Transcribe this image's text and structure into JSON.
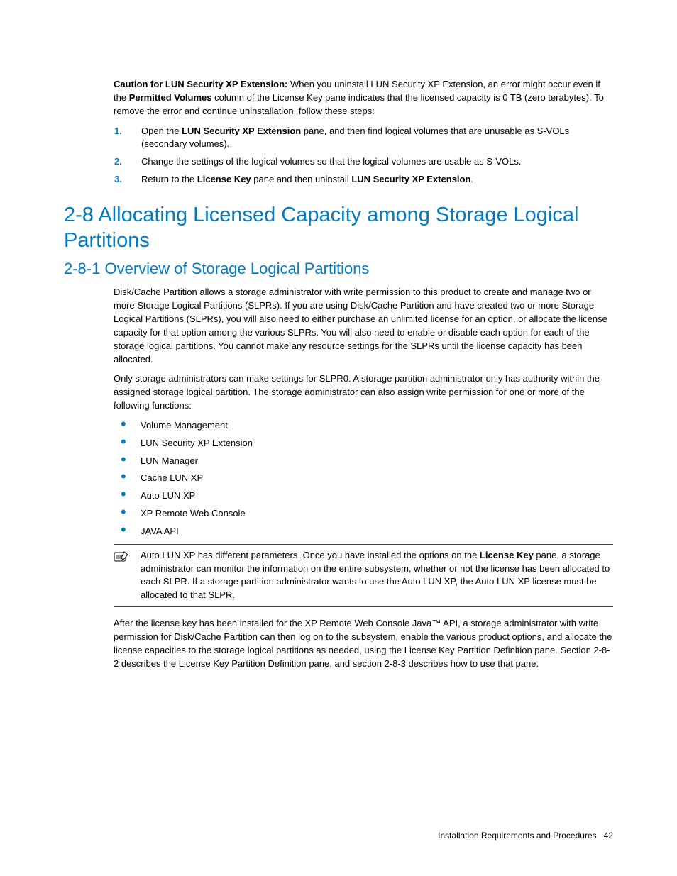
{
  "caution": {
    "lead_bold": "Caution for LUN Security XP Extension: ",
    "lead_text1": "When you uninstall LUN Security XP Extension, an error might occur even if the ",
    "bold_permitted": "Permitted Volumes",
    "lead_text2": " column of the License Key pane indicates that the licensed capacity is 0 TB (zero terabytes). To remove the error and continue uninstallation, follow these steps:"
  },
  "steps": [
    {
      "num": "1.",
      "pre": "Open the ",
      "bold": "LUN Security XP Extension",
      "post": " pane, and then find logical volumes that are unusable as S-VOLs (secondary volumes)."
    },
    {
      "num": "2.",
      "text": "Change the settings of the logical volumes so that the logical volumes are usable as S-VOLs."
    },
    {
      "num": "3.",
      "pre": "Return to the ",
      "bold1": "License Key",
      "mid": " pane and then uninstall ",
      "bold2": "LUN Security XP Extension",
      "post": "."
    }
  ],
  "h1": "2-8 Allocating Licensed Capacity among Storage Logical Partitions",
  "h2": "2-8-1 Overview of Storage Logical Partitions",
  "para1": "Disk/Cache Partition allows a storage administrator with write permission to this product to create and manage two or more Storage Logical Partitions (SLPRs). If you are using Disk/Cache Partition and have created two or more Storage Logical Partitions (SLPRs), you will also need to either purchase an unlimited license for an option, or allocate the license capacity for that option among the various SLPRs. You will also need to enable or disable each option for each of the storage logical partitions. You cannot make any resource settings for the SLPRs until the license capacity has been allocated.",
  "para2": "Only storage administrators can make settings for SLPR0. A storage partition administrator only has authority within the assigned storage logical partition. The storage administrator can also assign write permission for one or more of the following functions:",
  "bullets": [
    "Volume Management",
    "LUN Security XP Extension",
    "LUN Manager",
    "Cache LUN XP",
    "Auto LUN XP",
    "XP Remote Web Console",
    "JAVA API"
  ],
  "note": {
    "pre": "Auto LUN XP has different parameters. Once you have installed the options on the ",
    "bold": "License Key",
    "post": " pane, a storage administrator can monitor the information on the entire subsystem, whether or not the license has been allocated to each SLPR. If a storage partition administrator wants to use the Auto LUN XP, the Auto LUN XP license must be allocated to that SLPR."
  },
  "para3": "After the license key has been installed for the XP Remote Web Console Java™ API, a storage administrator with write permission for Disk/Cache Partition can then log on to the subsystem, enable the various product options, and allocate the license capacities to the storage logical partitions as needed, using the License Key Partition Definition pane. Section 2-8-2 describes the License Key Partition Definition pane, and section 2-8-3 describes how to use that pane.",
  "footer": {
    "title": "Installation Requirements and Procedures",
    "page": "42"
  }
}
